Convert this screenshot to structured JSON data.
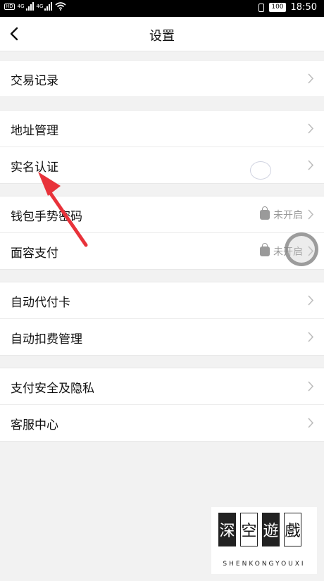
{
  "status_bar": {
    "network": "4G",
    "network2": "4G",
    "battery": "100",
    "time": "18:50"
  },
  "navbar": {
    "title": "设置"
  },
  "groups": [
    {
      "rows": [
        {
          "label": "交易记录"
        }
      ]
    },
    {
      "rows": [
        {
          "label": "地址管理"
        },
        {
          "label": "实名认证"
        }
      ]
    },
    {
      "rows": [
        {
          "label": "钱包手势密码",
          "status": "未开启"
        },
        {
          "label": "面容支付",
          "status": "未开启"
        }
      ]
    },
    {
      "rows": [
        {
          "label": "自动代付卡"
        },
        {
          "label": "自动扣费管理"
        }
      ]
    },
    {
      "rows": [
        {
          "label": "支付安全及隐私"
        },
        {
          "label": "客服中心"
        }
      ]
    }
  ],
  "icons": {
    "back": "chevron-left-icon",
    "row": "chevron-right-icon",
    "lock": "lock-icon"
  },
  "colors": {
    "annotation_arrow": "#e8323a",
    "background": "#f2f2f2"
  },
  "watermark": {
    "chars": [
      "深",
      "空",
      "遊",
      "戲"
    ],
    "text": "SHENKONGYOUXI"
  }
}
